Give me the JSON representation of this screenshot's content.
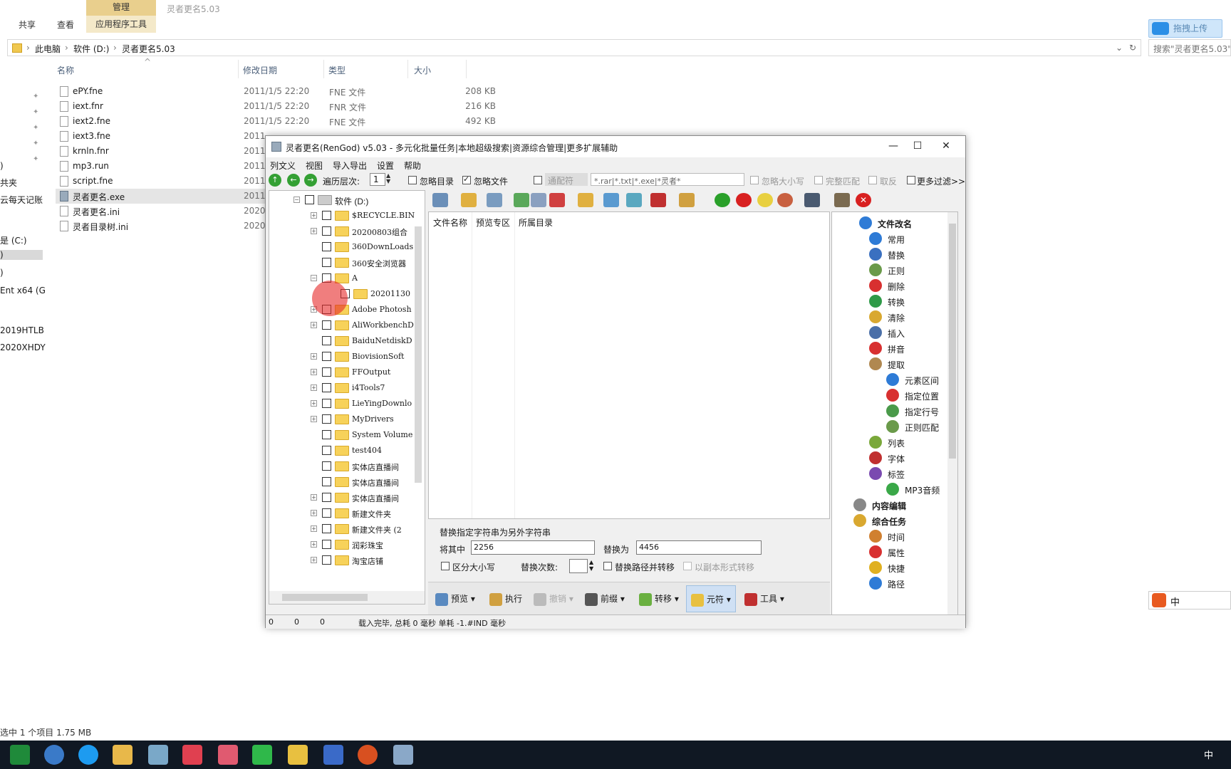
{
  "explorer": {
    "tabs": [
      "共享",
      "查看"
    ],
    "context_tab_top": "管理",
    "context_tab": "应用程序工具",
    "window_title": "灵者更名5.03",
    "upload_label": "拖拽上传",
    "breadcrumb": [
      "此电脑",
      "软件 (D:)",
      "灵者更名5.03"
    ],
    "search_placeholder": "搜索\"灵者更名5.03\"",
    "columns": {
      "name": "名称",
      "date": "修改日期",
      "type": "类型",
      "size": "大小"
    },
    "files": [
      {
        "name": "ePY.fne",
        "date": "2011/1/5 22:20",
        "type": "FNE 文件",
        "size": "208 KB"
      },
      {
        "name": "iext.fnr",
        "date": "2011/1/5 22:20",
        "type": "FNR 文件",
        "size": "216 KB"
      },
      {
        "name": "iext2.fne",
        "date": "2011/1/5 22:20",
        "type": "FNE 文件",
        "size": "492 KB"
      },
      {
        "name": "iext3.fne",
        "date": "2011",
        "type": "",
        "size": ""
      },
      {
        "name": "krnln.fnr",
        "date": "2011",
        "type": "",
        "size": ""
      },
      {
        "name": "mp3.run",
        "date": "2011",
        "type": "",
        "size": ""
      },
      {
        "name": "script.fne",
        "date": "2011",
        "type": "",
        "size": ""
      },
      {
        "name": "灵者更名.exe",
        "date": "2011",
        "type": "",
        "size": ""
      },
      {
        "name": "灵者更名.ini",
        "date": "2020",
        "type": "",
        "size": ""
      },
      {
        "name": "灵者目录树.ini",
        "date": "2020",
        "type": "",
        "size": ""
      }
    ],
    "nav_items": [
      ")",
      "共夹",
      "云每天记账",
      "是 (C:)",
      ")",
      ")",
      "Ent x64 (G",
      "2019HTLB",
      "2020XHDY"
    ],
    "status": "选中 1 个项目  1.75 MB"
  },
  "app": {
    "title": "灵者更名(RenGod) v5.03 - 多元化批量任务|本地超级搜索|资源综合管理|更多扩展辅助",
    "menus": [
      "列文义",
      "视图",
      "导入导出",
      "设置",
      "帮助"
    ],
    "filter": {
      "depth_label": "遍历层次:",
      "depth_value": "1",
      "ignore_dir": "忽略目录",
      "ignore_file": "忽略文件",
      "wildcard": "通配符",
      "pattern": "*.rar|*.txt|*.exe|*灵者*",
      "ignore_case": "忽略大小写",
      "full_match": "完整匹配",
      "invert": "取反",
      "more_filter": "更多过滤>>"
    },
    "tree": {
      "root": "软件 (D:)",
      "items": [
        "$RECYCLE.BIN",
        "20200803组合",
        "360DownLoads",
        "360安全浏览器",
        "A",
        "20201130",
        "Adobe Photosh",
        "AliWorkbenchD",
        "BaiduNetdiskD",
        "BiovisionSoft",
        "FFOutput",
        "i4Tools7",
        "LieYingDownlo",
        "MyDrivers",
        "System Volume",
        "test404",
        "实体店直播间",
        "实体店直播间",
        "实体店直播间",
        "新建文件夹",
        "新建文件夹 (2",
        "润彩珠宝",
        "淘宝店铺"
      ]
    },
    "list_headers": [
      "文件名称",
      "预览专区",
      "所属目录"
    ],
    "replace": {
      "title": "替换指定字符串为另外字符串",
      "from_label": "将其中",
      "from_value": "2256",
      "to_label": "替换为",
      "to_value": "4456",
      "case_label": "区分大小写",
      "count_label": "替换次数:",
      "path_label": "替换路径并转移",
      "copy_label": "以副本形式转移"
    },
    "actions": [
      "预览",
      "执行",
      "撤销",
      "前缀",
      "转移",
      "元符",
      "工具"
    ],
    "functions": [
      {
        "label": "文件改名",
        "bold": true,
        "color": "#2e7bd6"
      },
      {
        "label": "常用",
        "color": "#2e7bd6"
      },
      {
        "label": "替换",
        "color": "#3a70c0"
      },
      {
        "label": "正则",
        "color": "#6a9a4a"
      },
      {
        "label": "删除",
        "color": "#d83030"
      },
      {
        "label": "转换",
        "color": "#2f9a48"
      },
      {
        "label": "清除",
        "color": "#d9a830"
      },
      {
        "label": "插入",
        "color": "#4a6fa8"
      },
      {
        "label": "拼音",
        "color": "#d83030"
      },
      {
        "label": "提取",
        "color": "#b08850"
      },
      {
        "label": "元素区间",
        "color": "#2e7bd6"
      },
      {
        "label": "指定位置",
        "color": "#d83030"
      },
      {
        "label": "指定行号",
        "color": "#4a9a4a"
      },
      {
        "label": "正则匹配",
        "color": "#6a9a4a"
      },
      {
        "label": "列表",
        "color": "#7aa83a"
      },
      {
        "label": "字体",
        "color": "#c03030"
      },
      {
        "label": "标签",
        "color": "#7a4ab0"
      },
      {
        "label": "MP3音频",
        "color": "#3aa848"
      },
      {
        "label": "内容编辑",
        "bold": true,
        "color": "#888888"
      },
      {
        "label": "综合任务",
        "bold": true,
        "color": "#d9a830"
      },
      {
        "label": "时间",
        "color": "#d08030"
      },
      {
        "label": "属性",
        "color": "#d83030"
      },
      {
        "label": "快捷",
        "color": "#e0b020"
      },
      {
        "label": "路径",
        "color": "#2e7bd6"
      }
    ],
    "status": {
      "c1": "0",
      "c2": "0",
      "c3": "0",
      "message": "载入完毕, 总耗 0 毫秒 单耗 -1.#IND 毫秒"
    }
  },
  "ime": "中"
}
